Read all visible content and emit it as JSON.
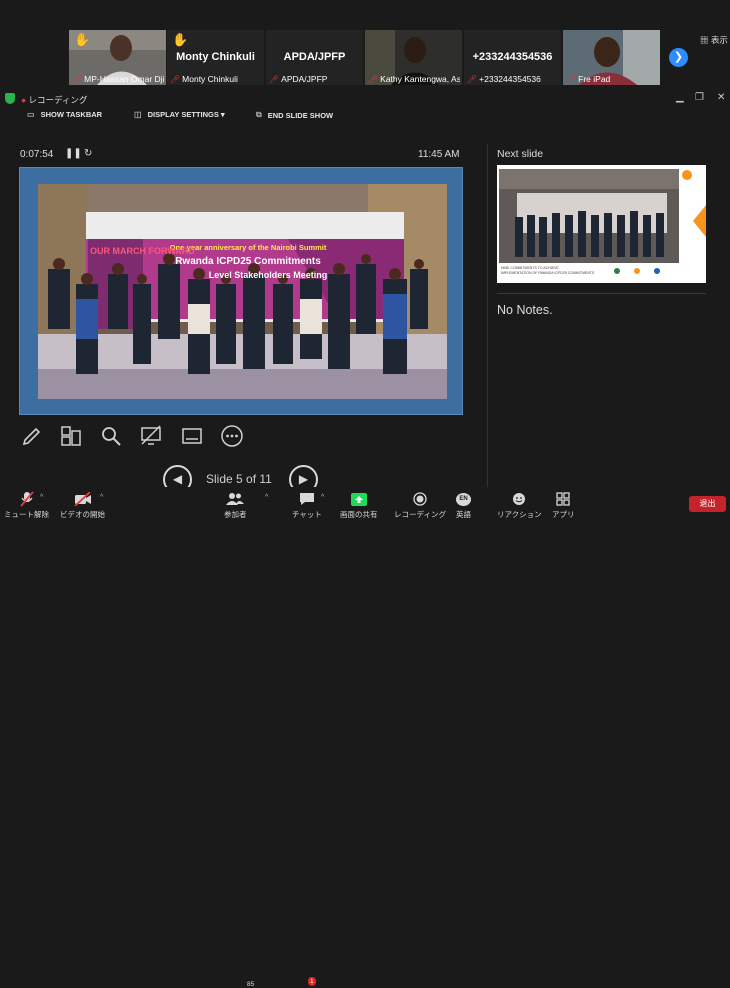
{
  "gallery": {
    "tiles": [
      {
        "caption": "MP-Hassan Omar Djib..."
      },
      {
        "big_name": "Monty Chinkuli",
        "caption": "Monty Chinkuli"
      },
      {
        "big_name": "APDA/JPFP",
        "caption": "APDA/JPFP"
      },
      {
        "caption": "Kathy Kantengwa, Assista..."
      },
      {
        "big_name": "+233244354536",
        "caption": "+233244354536"
      },
      {
        "caption": "Fre iPad"
      }
    ],
    "view_label": "表示"
  },
  "titlebar": {
    "recording": "レコーディング"
  },
  "presenter_toolbar": {
    "show_taskbar": "SHOW TASKBAR",
    "display_settings": "DISPLAY SETTINGS ▾",
    "end_slide_show": "END SLIDE SHOW"
  },
  "presenter": {
    "elapsed": "0:07:54",
    "clock": "11:45 AM",
    "slide_counter": "Slide 5 of 11",
    "next_slide_label": "Next slide",
    "notes": "No Notes."
  },
  "slide": {
    "banner_line1": "One-year anniversary of the Nairobi Summit",
    "banner_line2": "Rwanda ICPD25 Commitments",
    "banner_line3": "Level Stakeholders Meeting",
    "side_banner": "OUR MARCH FORWARD"
  },
  "next_slide": {
    "caption_line1": "NINE COMMITMENTS TO ACHIEVE",
    "caption_line2": "IMPLEMENTATION OF RWANDA ICPD25 COMMITMENTS"
  },
  "bottombar": {
    "mute": "ミュート解除",
    "video": "ビデオの開始",
    "participants": "参加者",
    "participants_count": "85",
    "chat": "チャット",
    "chat_badge": "1",
    "share": "画面の共有",
    "recording": "レコーディング",
    "language": "英語",
    "language_code": "EN",
    "reactions": "リアクション",
    "apps": "アプリ",
    "leave": "退出"
  },
  "colors": {
    "accent": "#2d8cff",
    "leave": "#c4232b",
    "share": "#23d959",
    "muted": "#e23b3b"
  }
}
